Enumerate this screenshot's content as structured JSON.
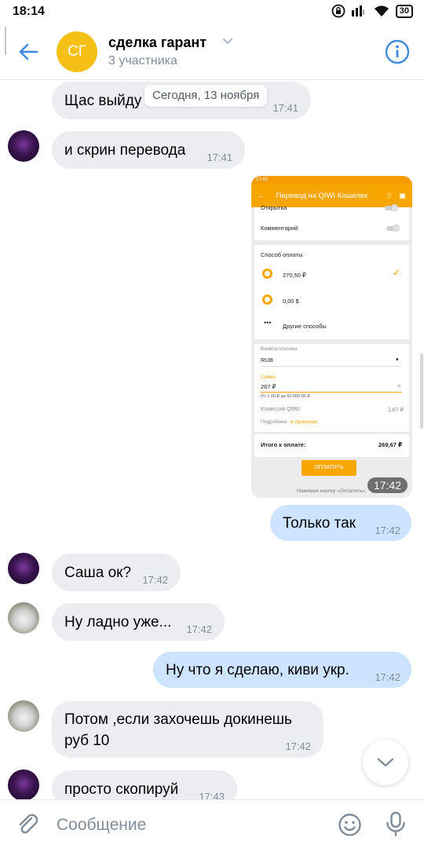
{
  "status_bar": {
    "time": "18:14",
    "battery": "30"
  },
  "header": {
    "avatar_initials": "СГ",
    "title": "сделка гарант",
    "subtitle": "3 участника"
  },
  "date_divider": "Сегодня, 13 ноября",
  "messages": [
    {
      "text": "Щас выйду",
      "time": "17:41",
      "direction": "in"
    },
    {
      "text": "и скрин перевода",
      "time": "17:41",
      "direction": "in"
    },
    {
      "time": "17:42",
      "direction": "out",
      "kind": "photo"
    },
    {
      "text": "Только так",
      "time": "17:42",
      "direction": "out"
    },
    {
      "text": "Саша ок?",
      "time": "17:42",
      "direction": "in"
    },
    {
      "text": "Ну ладно уже...",
      "time": "17:42",
      "direction": "in"
    },
    {
      "text": "Ну что я сделаю, киви укр.",
      "time": "17:42",
      "direction": "out"
    },
    {
      "text_line1": "Потом ,если захочешь докинешь",
      "text_line2": "руб 10",
      "time": "17:42",
      "direction": "in"
    },
    {
      "text": "просто скопируй",
      "time": "17:43",
      "direction": "in"
    }
  ],
  "screenshot": {
    "status_time": "17:42",
    "bar_title": "Перевод на QIWI Кошелек",
    "row_open": "Открытка",
    "row_comment": "Комментарий",
    "pay_method_title": "Способ оплаты",
    "method_1": "270,50 ₽",
    "method_2": "0,00 $",
    "method_3": "Другие способы",
    "currency_label": "Валюта платежа",
    "currency_value": "RUB",
    "amount_label": "Сумма",
    "amount_value": "267 ₽",
    "amount_hint": "От 1,00 ₽ до 60 000,00 ₽",
    "fee_label": "Комиссия QIWI:",
    "fee_value": "2,67 ₽",
    "details_prefix": "Подробнее",
    "details_link": "в примерах",
    "total_label": "Итого к оплате:",
    "total_value": "269,67 ₽",
    "pay_button": "ОПЛАТИТЬ",
    "footer": "Нажимая кнопку «Оплатить»,"
  },
  "composer": {
    "placeholder": "Сообщение"
  },
  "colors": {
    "accent": "#3f8ae0",
    "incoming": "#ebedf0",
    "outgoing": "#cce4ff",
    "qiwi_orange": "#f7a600"
  }
}
